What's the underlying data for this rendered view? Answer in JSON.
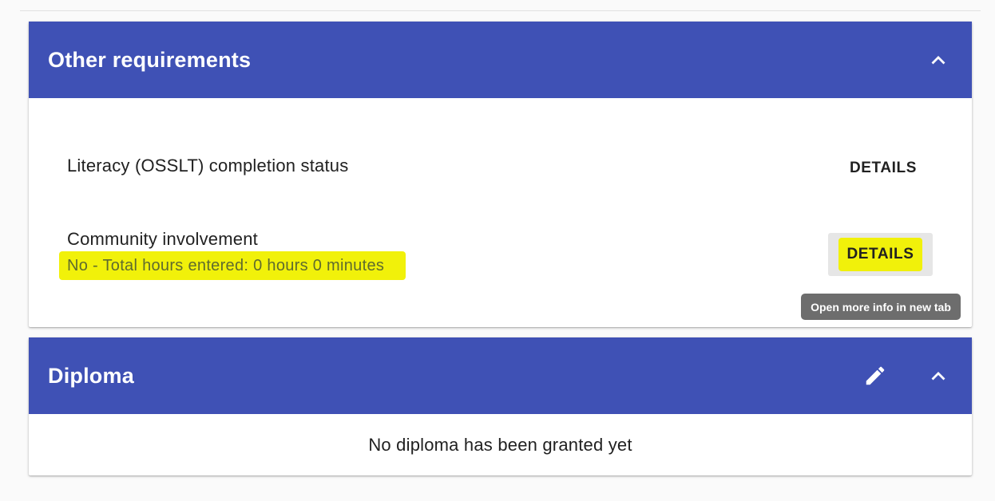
{
  "other_requirements": {
    "title": "Other requirements",
    "literacy": {
      "label": "Literacy (OSSLT) completion status",
      "details_label": "DETAILS"
    },
    "community": {
      "label": "Community involvement",
      "status": "No - Total hours entered: 0 hours 0 minutes",
      "details_label": "DETAILS",
      "tooltip": "Open more info in new tab"
    }
  },
  "diploma": {
    "title": "Diploma",
    "message": "No diploma has been granted yet"
  },
  "colors": {
    "header": "#3f51b5",
    "highlight": "#f1f10a",
    "tooltip": "#6d6d6d"
  },
  "icons": {
    "collapse": "chevron-up-icon",
    "edit": "pencil-icon"
  }
}
